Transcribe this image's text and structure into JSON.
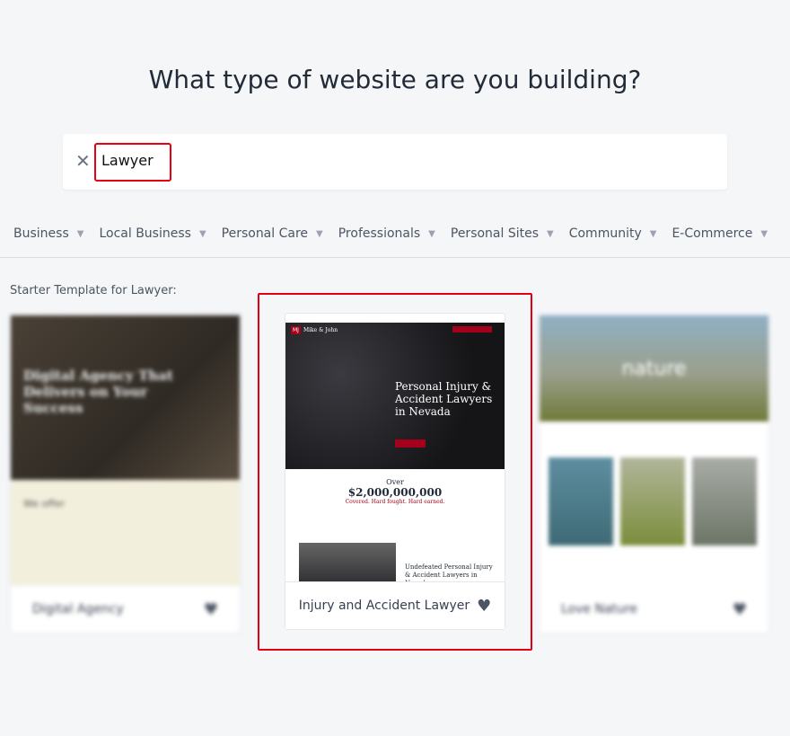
{
  "title": "What type of website are you building?",
  "search": {
    "value": "Lawyer",
    "clear_icon": "close-icon"
  },
  "categories": [
    "Business",
    "Local Business",
    "Personal Care",
    "Professionals",
    "Personal Sites",
    "Community",
    "E-Commerce"
  ],
  "subtitle": "Starter Template for Lawyer:",
  "templates": [
    {
      "name": "Digital Agency",
      "hero": "Digital Agency That Delivers on Your Success",
      "section": "We offer"
    },
    {
      "name": "Injury and Accident Lawyer",
      "logo": "Mike & John",
      "hero": "Personal Injury & Accident Lawyers in Nevada",
      "over": "Over",
      "amount": "$2,000,000,000",
      "tagline": "Covered. Hard fought. Hard earned.",
      "section": "Undefeated Personal Injury & Accident Lawyers in Nevada"
    },
    {
      "name": "Love Nature",
      "hero": "nature"
    }
  ],
  "colors": {
    "highlight": "#e60012",
    "brand_red": "#a3001b"
  }
}
